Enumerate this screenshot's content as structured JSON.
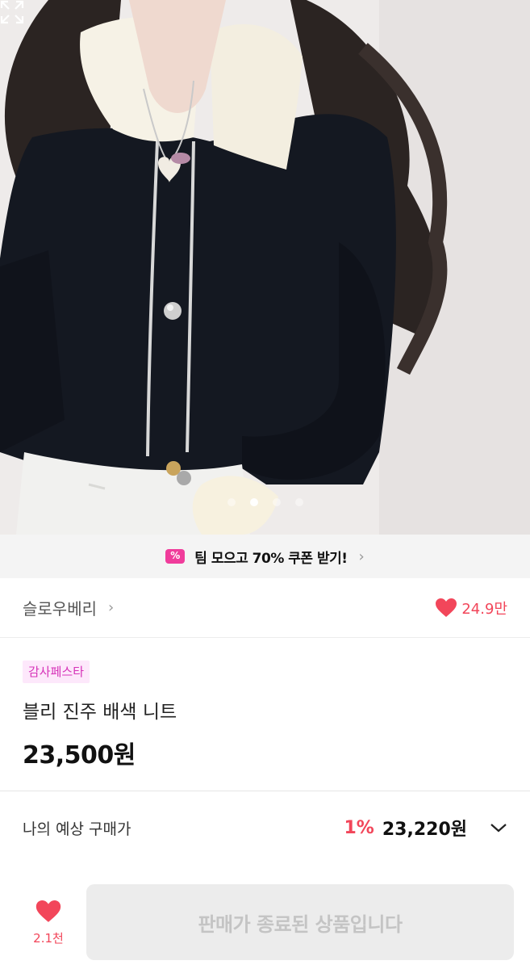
{
  "carousel": {
    "total": 4,
    "active_index": 1,
    "expand_icon": "expand-icon"
  },
  "coupon": {
    "text": "팀 모으고 70% 쿠폰 받기!",
    "icon_text": "%",
    "chevron": "›"
  },
  "shop": {
    "name": "슬로우베리",
    "chevron": "›",
    "likes": "24.9만"
  },
  "product": {
    "badge": "감사페스타",
    "title": "블리 진주 배색 니트",
    "price": "23,500원"
  },
  "expected": {
    "label": "나의 예상 구매가",
    "rate": "1%",
    "price": "23,220원"
  },
  "bottom": {
    "wish_count": "2.1천",
    "status": "판매가 종료된 상품입니다"
  },
  "colors": {
    "accent": "#f2465a",
    "badge_text": "#d632b8",
    "coupon_icon": "#f03c9b"
  }
}
